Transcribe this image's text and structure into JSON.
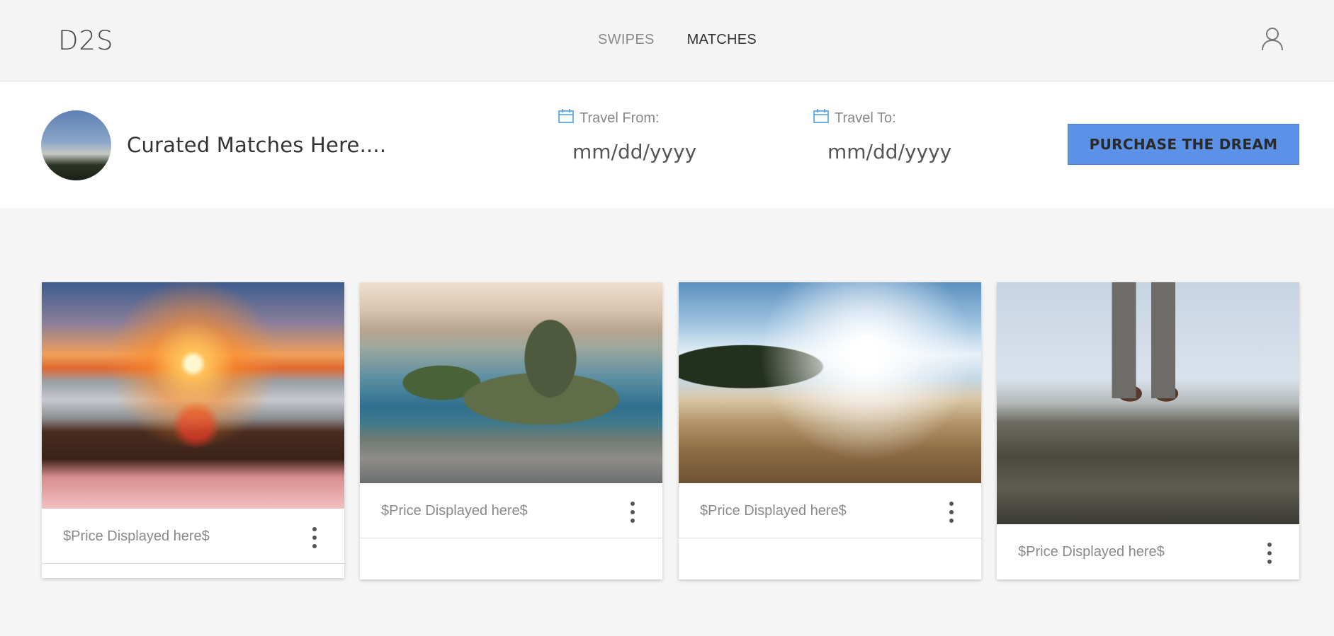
{
  "app": {
    "brand": "D2S"
  },
  "nav": {
    "items": [
      {
        "label": "SWIPES",
        "active": false
      },
      {
        "label": "MATCHES",
        "active": true
      }
    ],
    "user_icon": "user-icon"
  },
  "header": {
    "title": "Curated Matches Here....",
    "travel_from": {
      "label": "Travel From:",
      "placeholder": "mm/dd/yyyy",
      "icon": "calendar-icon"
    },
    "travel_to": {
      "label": "Travel To:",
      "placeholder": "mm/dd/yyyy",
      "icon": "calendar-icon"
    },
    "purchase_label": "PURCHASE THE DREAM"
  },
  "colors": {
    "accent": "#5b92e8",
    "calendar_icon": "#4a9ee0"
  },
  "cards": [
    {
      "price": "$Price Displayed here$",
      "menu_icon": "more-vertical-icon"
    },
    {
      "price": "$Price Displayed here$",
      "menu_icon": "more-vertical-icon"
    },
    {
      "price": "$Price Displayed here$",
      "menu_icon": "more-vertical-icon"
    },
    {
      "price": "$Price Displayed here$",
      "menu_icon": "more-vertical-icon"
    }
  ]
}
